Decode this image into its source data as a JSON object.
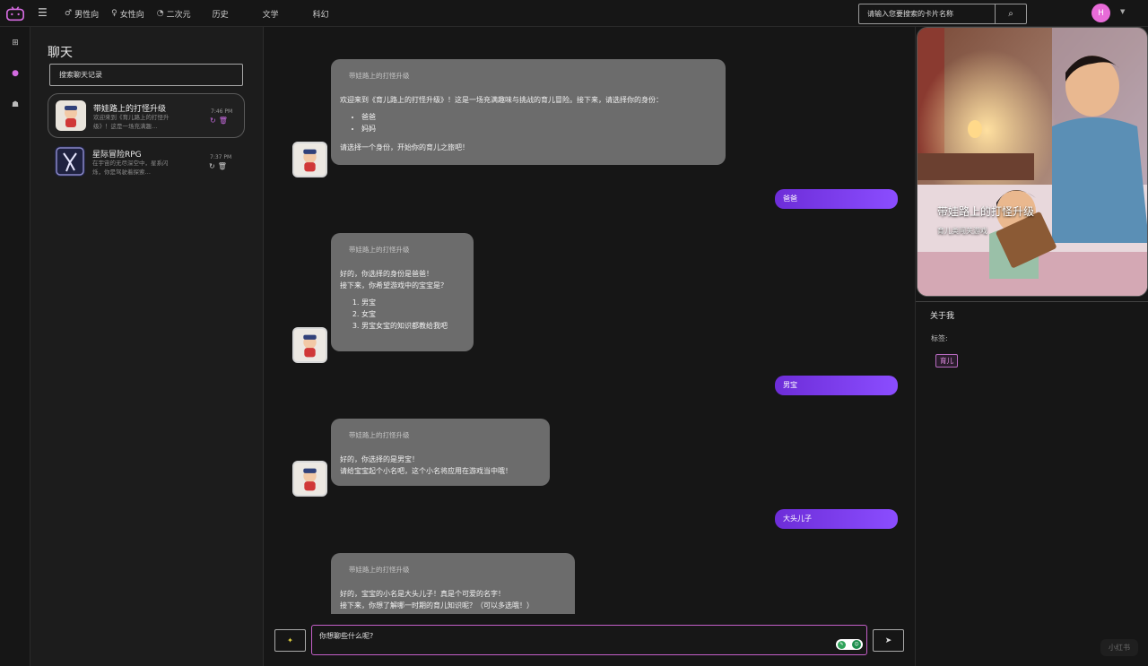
{
  "topbar": {
    "nav": [
      {
        "label": "男性向",
        "icon": "male-icon",
        "glyph": "♂"
      },
      {
        "label": "女性向",
        "icon": "female-icon",
        "glyph": "♀"
      },
      {
        "label": "二次元",
        "icon": "circle-c-icon",
        "glyph": "◔"
      },
      {
        "label": "历史"
      },
      {
        "label": "文学"
      },
      {
        "label": "科幻"
      }
    ],
    "search": {
      "placeholder": "请输入您要搜索的卡片名称"
    },
    "avatar_initial": "H"
  },
  "chatlist": {
    "title": "聊天",
    "search_placeholder": "搜索聊天记录",
    "items": [
      {
        "name": "带娃路上的打怪升级",
        "preview": "欢迎来到《育儿路上的打怪升级》！这是一场充满趣…",
        "time": "7:46 PM"
      },
      {
        "name": "星际冒险RPG",
        "preview": "在宇宙的无尽深空中，星系闪烁，你是驾驶着探索…",
        "time": "7:37 PM"
      }
    ]
  },
  "messages": {
    "m1": {
      "sender": "带娃路上的打怪升级",
      "intro": "欢迎来到《育儿路上的打怪升级》！这是一场充满趣味与挑战的育儿冒险。接下来，请选择你的身份：",
      "options": [
        "爸爸",
        "妈妈"
      ],
      "outro": "请选择一个身份，开始你的育儿之旅吧！"
    },
    "u1": "爸爸",
    "m2": {
      "sender": "带娃路上的打怪升级",
      "line1": "好的，你选择的身份是爸爸！",
      "line2": "接下来，你希望游戏中的宝宝是？",
      "options": [
        "男宝",
        "女宝",
        "男宝女宝的知识都教给我吧"
      ]
    },
    "u2": "男宝",
    "m3": {
      "sender": "带娃路上的打怪升级",
      "line1": "好的，你选择的是男宝！",
      "line2": "请给宝宝起个小名吧，这个小名将应用在游戏当中哦！"
    },
    "u3": "大头儿子",
    "m4": {
      "sender": "带娃路上的打怪升级",
      "line1": "好的，宝宝的小名是大头儿子！真是个可爱的名字！",
      "line2": "接下来，你想了解哪一时期的育儿知识呢？（可以多选哦！）"
    }
  },
  "composer": {
    "placeholder": "你想聊些什么呢?"
  },
  "right": {
    "card_title": "带娃路上的打怪升级",
    "card_sub": "育儿类闯关游戏",
    "about": "关于我",
    "tags_label": "标签:",
    "tags": [
      "育儿"
    ]
  },
  "watermark": "小红书",
  "colors": {
    "accent": "#8b4dff",
    "brand": "#d26be0",
    "bot_bubble": "#6c6c6c"
  }
}
